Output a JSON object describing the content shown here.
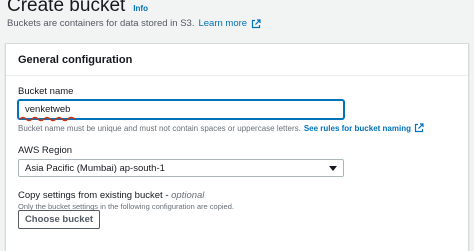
{
  "header": {
    "title": "Create bucket",
    "info_label": "Info",
    "subtitle": "Buckets are containers for data stored in S3.",
    "learn_more": "Learn more"
  },
  "general_config": {
    "title": "General configuration",
    "bucket_name": {
      "label": "Bucket name",
      "value": "venketweb",
      "hint": "Bucket name must be unique and must not contain spaces or uppercase letters.",
      "hint_link": "See rules for bucket naming"
    },
    "region": {
      "label": "AWS Region",
      "selected": "Asia Pacific (Mumbai) ap-south-1"
    },
    "copy_settings": {
      "label": "Copy settings from existing bucket -",
      "optional": "optional",
      "hint": "Only the bucket settings in the following configuration are copied.",
      "button": "Choose bucket"
    }
  },
  "colors": {
    "link": "#0073bb",
    "focus_border": "#0073bb",
    "spellcheck_underline": "#d13212"
  },
  "icons": [
    "external-link-icon",
    "dropdown-caret-icon"
  ]
}
